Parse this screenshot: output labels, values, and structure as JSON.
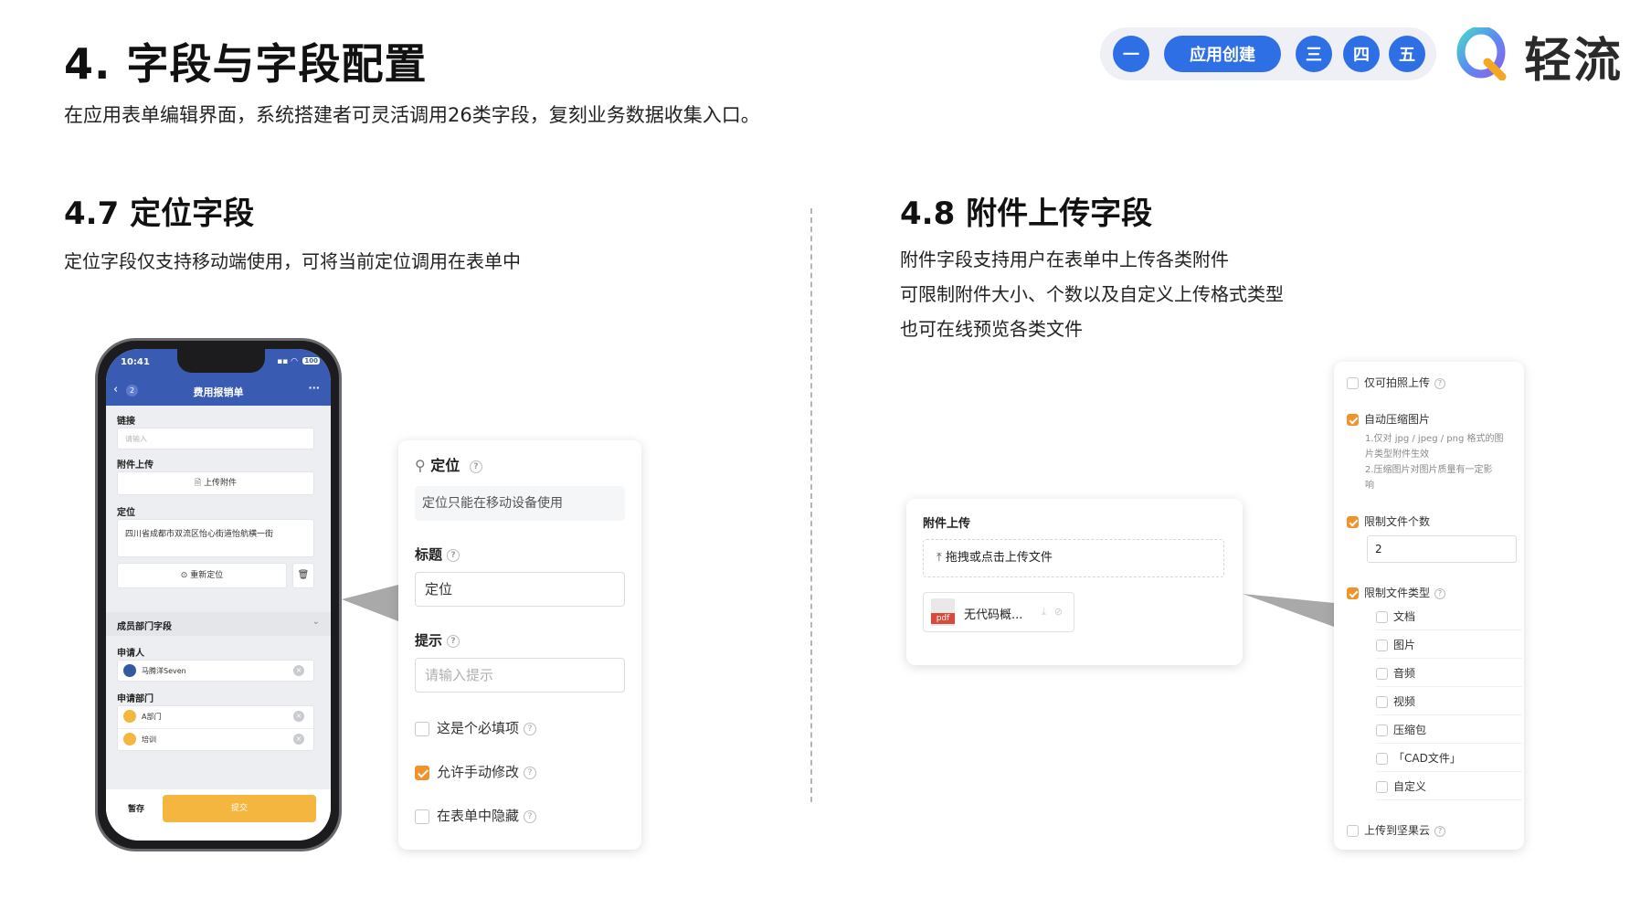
{
  "header": {
    "title": "4. 字段与字段配置",
    "subtitle": "在应用表单编辑界面，系统搭建者可灵活调用26类字段，复刻业务数据收集入口。",
    "nav": [
      "一",
      "应用创建",
      "三",
      "四",
      "五"
    ],
    "brand_name": "轻流"
  },
  "left_section": {
    "title": "4.7 定位字段",
    "desc": "定位字段仅支持移动端使用，可将当前定位调用在表单中"
  },
  "right_section": {
    "title": "4.8 附件上传字段",
    "desc_lines": [
      "附件字段支持用户在表单中上传各类附件",
      "可限制附件大小、个数以及自定义上传格式类型",
      "也可在线预览各类文件"
    ]
  },
  "phone": {
    "time": "10:41",
    "battery": "100",
    "back_count": "2",
    "nav_title": "费用报销单",
    "more": "···",
    "link_label": "链接",
    "link_placeholder": "请输入",
    "attach_label": "附件上传",
    "attach_btn": "上传附件",
    "location_label": "定位",
    "location_value": "四川省成都市双流区怡心街道怡航横一街",
    "relocate_btn": "重新定位",
    "member_section": "成员部门字段",
    "applicant_label": "申请人",
    "applicant_value": "马腾洋Seven",
    "dept_label": "申请部门",
    "dept_values": [
      "A部门",
      "培训"
    ],
    "save_btn": "暂存",
    "submit_btn": "提交"
  },
  "location_card": {
    "title": "定位",
    "notice": "定位只能在移动设备使用",
    "title_label": "标题",
    "title_value": "定位",
    "hint_label": "提示",
    "hint_placeholder": "请输入提示",
    "options": [
      {
        "label": "这是个必填项",
        "checked": false
      },
      {
        "label": "允许手动修改",
        "checked": true
      },
      {
        "label": "在表单中隐藏",
        "checked": false
      }
    ]
  },
  "attach_card": {
    "label": "附件上传",
    "upload_text": "拖拽或点击上传文件",
    "file_name": "无代码概...",
    "file_type": "pdf"
  },
  "attach_settings": {
    "photo_only": {
      "label": "仅可拍照上传",
      "checked": false
    },
    "compress": {
      "label": "自动压缩图片",
      "checked": true
    },
    "compress_notes": [
      "1.仅对 jpg / jpeg / png 格式的图",
      "片类型附件生效",
      "2.压缩图片对图片质量有一定影",
      "响"
    ],
    "limit_count": {
      "label": "限制文件个数",
      "checked": true,
      "value": "2"
    },
    "limit_type": {
      "label": "限制文件类型",
      "checked": true
    },
    "types": [
      "文档",
      "图片",
      "音频",
      "视频",
      "压缩包",
      "「CAD文件」",
      "自定义"
    ],
    "cloud": {
      "label": "上传到坚果云",
      "checked": false
    }
  },
  "colors": {
    "accent_blue": "#2f6fe6",
    "phone_header": "#3a5bb2",
    "checkbox_orange": "#f0932b",
    "submit_yellow": "#f4b63f"
  }
}
